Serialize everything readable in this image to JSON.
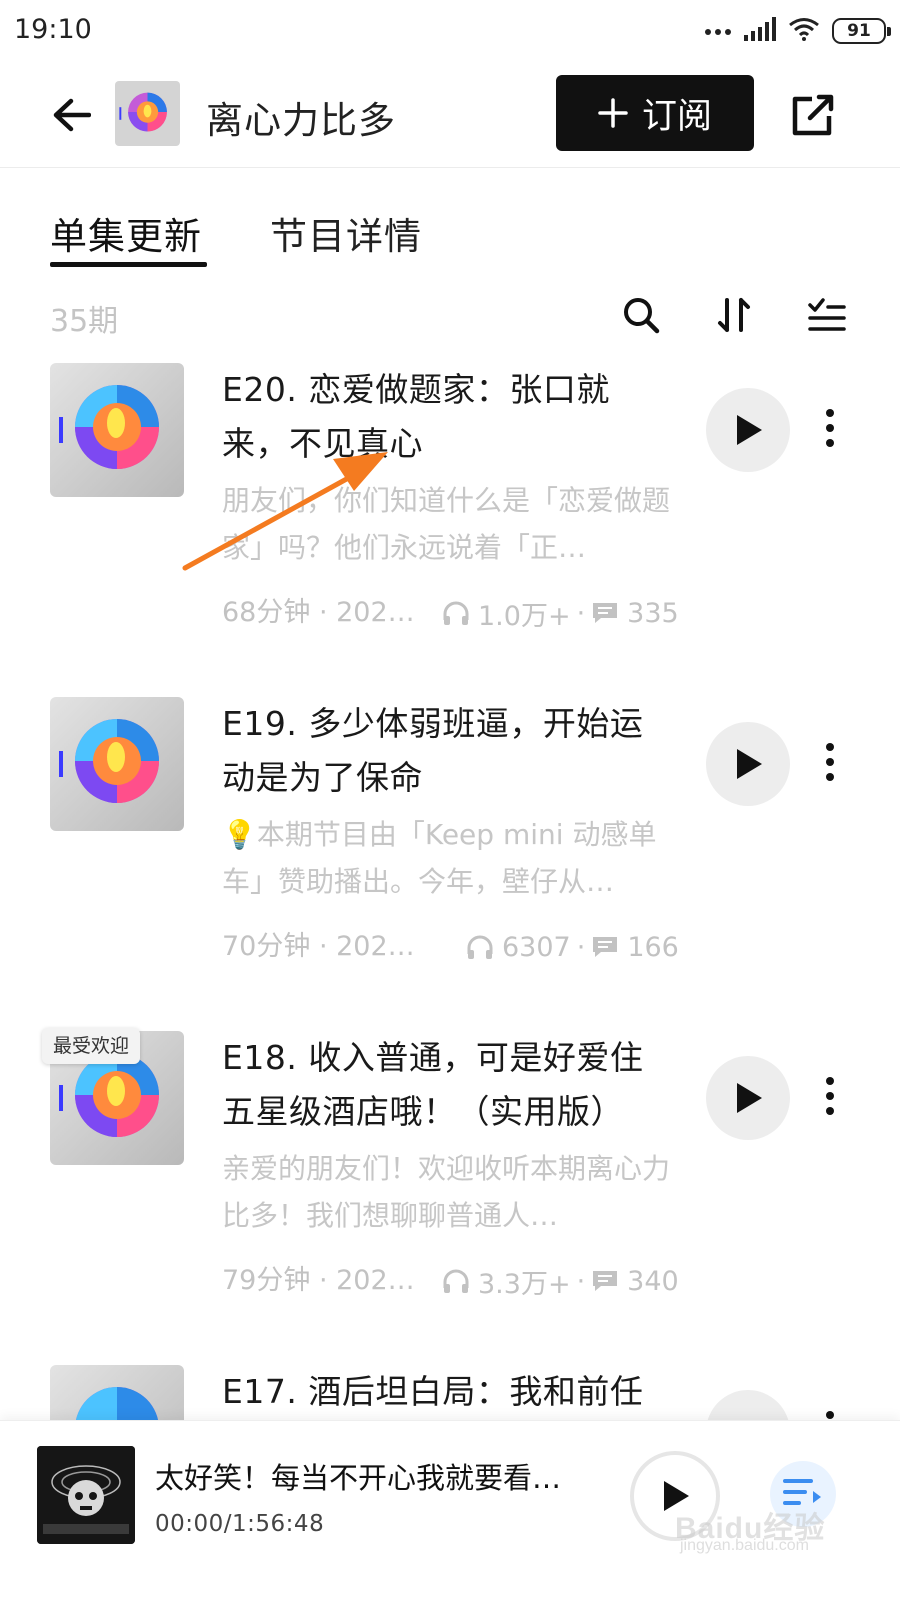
{
  "status_bar": {
    "time": "19:10",
    "battery": "91"
  },
  "header": {
    "podcast_title": "离心力比多",
    "subscribe_label": "订阅"
  },
  "tabs": [
    {
      "label": "单集更新",
      "active": true
    },
    {
      "label": "节目详情",
      "active": false
    }
  ],
  "list": {
    "count_label": "35期"
  },
  "episodes": [
    {
      "title": "E20. 恋爱做题家：张口就来，不见真心",
      "description": "朋友们，你们知道什么是「恋爱做题家」吗？他们永远说着「正…",
      "duration": "68分钟 · 2022…",
      "plays": "1.0万+",
      "comments": "335"
    },
    {
      "title": "E19. 多少体弱班逼，开始运动是为了保命",
      "description": "💡本期节目由「Keep mini 动感单车」赞助播出。今年，壁仔从…",
      "duration": "70分钟 · 2022/…",
      "plays": "6307",
      "comments": "166"
    },
    {
      "title": "E18. 收入普通，可是好爱住五星级酒店哦！（实用版）",
      "description": "亲爱的朋友们！欢迎收听本期离心力比多！我们想聊聊普通人…",
      "duration": "79分钟 · 2022…",
      "plays": "3.3万+",
      "comments": "340",
      "badge": "最受欢迎"
    },
    {
      "title": "E17. 酒后坦白局：我和前任"
    }
  ],
  "mini_player": {
    "title": "太好笑！每当不开心我就要看…",
    "time": "00:00/1:56:48"
  },
  "watermark": {
    "brand": "Baidu经验",
    "url": "jingyan.baidu.com"
  },
  "colors": {
    "accent": "#111111",
    "annotation_arrow": "#f47b20",
    "muted_text": "#c4c4c4"
  }
}
